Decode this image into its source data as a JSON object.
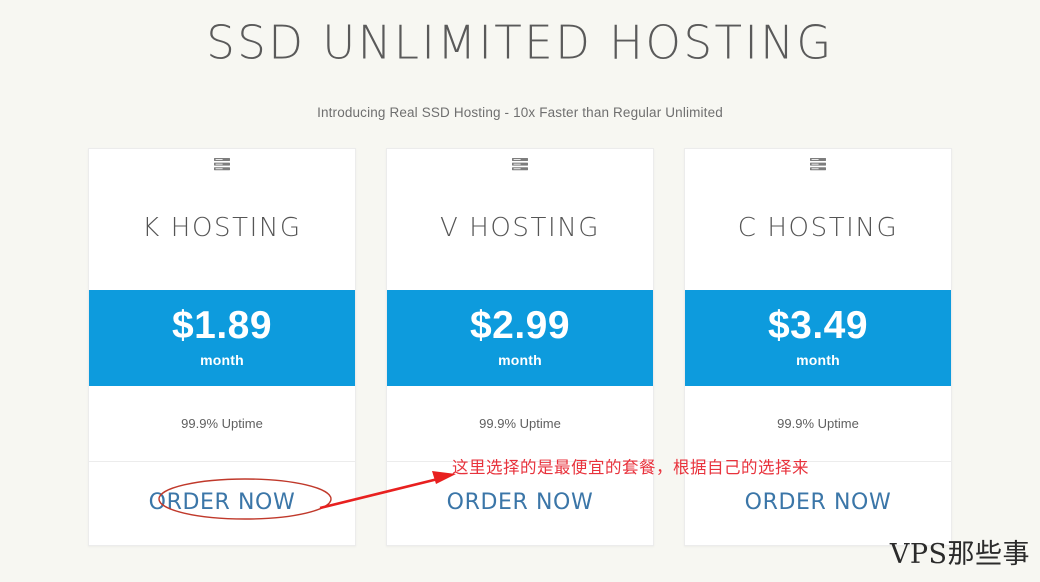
{
  "header": {
    "title": "SSD UNLIMITED HOSTING",
    "subtitle": "Introducing Real SSD Hosting - 10x Faster than Regular Unlimited"
  },
  "theme": {
    "page_background": "#f7f7f2",
    "price_band_color": "#0d9bdd",
    "cta_link_color": "#3b76a8",
    "title_color": "#5a5a5a",
    "annotation_color": "#e8323c"
  },
  "plans": [
    {
      "icon": "server-stack-icon",
      "name": "K HOSTING",
      "price": "$1.89",
      "period": "month",
      "feature": "99.9% Uptime",
      "cta": "ORDER NOW"
    },
    {
      "icon": "server-stack-icon",
      "name": "V HOSTING",
      "price": "$2.99",
      "period": "month",
      "feature": "99.9% Uptime",
      "cta": "ORDER NOW"
    },
    {
      "icon": "server-stack-icon",
      "name": "C HOSTING",
      "price": "$3.49",
      "period": "month",
      "feature": "99.9% Uptime",
      "cta": "ORDER NOW"
    }
  ],
  "annotations": {
    "note_text": "这里选择的是最便宜的套餐，根据自己的选择来",
    "highlight_target": "ORDER NOW",
    "shapes": [
      "red-ellipse-highlight",
      "red-arrow"
    ]
  },
  "watermark": {
    "text": "VPS那些事"
  }
}
